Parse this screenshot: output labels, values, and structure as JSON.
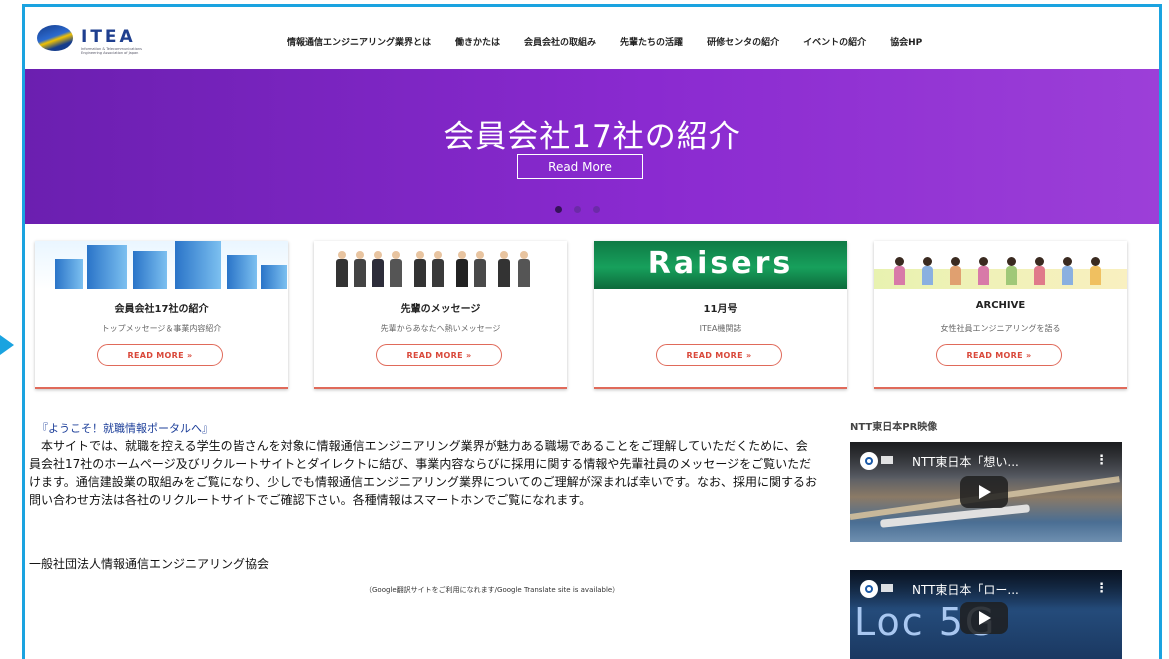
{
  "logo": {
    "name": "ITEA",
    "subtitle": "Information & Telecommunications Engineering Association of Japan"
  },
  "nav": [
    "情報通信エンジニアリング業界とは",
    "働きかたは",
    "会員会社の取組み",
    "先輩たちの活躍",
    "研修センタの紹介",
    "イベントの紹介",
    "協会HP"
  ],
  "hero": {
    "title": "会員会社17社の紹介",
    "button": "Read More",
    "slides": 3,
    "active_slide": 1
  },
  "cards": [
    {
      "title": "会員会社17社の紹介",
      "desc": "トップメッセージ＆事業内容紹介",
      "button": "READ MORE »",
      "image": "buildings-image"
    },
    {
      "title": "先輩のメッセージ",
      "desc": "先輩からあなたへ熱いメッセージ",
      "button": "READ MORE »",
      "image": "employees-image"
    },
    {
      "title": "11月号",
      "desc": "ITEA機関誌",
      "button": "READ MORE »",
      "image": "raisers-image",
      "image_text": "Raisers"
    },
    {
      "title": "ARCHIVE",
      "desc": "女性社員エンジニアリングを語る",
      "button": "READ MORE »",
      "image": "women-image"
    }
  ],
  "welcome": {
    "heading": "『ようこそ！就職情報ポータルへ』",
    "body": "　本サイトでは、就職を控える学生の皆さんを対象に情報通信エンジニアリング業界が魅力ある職場であることをご理解していただくために、会員会社17社のホームページ及びリクルートサイトとダイレクトに結び、事業内容ならびに採用に関する情報や先輩社員のメッセージをご覧いただけます。通信建設業の取組みをご覧になり、少しでも情報通信エンジニアリング業界についてのご理解が深まれば幸いです。なお、採用に関するお問い合わせ方法は各社のリクルートサイトでご確認下さい。各種情報はスマートホンでご覧になれます。",
    "org": "一般社団法人情報通信エンジニアリング協会",
    "translate_note": "（Google翻訳サイトをご利用になれます/Google Translate site is available）"
  },
  "sidebar": {
    "heading": "NTT東日本PR映像",
    "videos": [
      {
        "title": "NTT東日本「想い...",
        "menu": "⋮"
      },
      {
        "title": "NTT東日本「ロー...",
        "menu": "⋮",
        "overlay_text": "Loc 5G"
      }
    ]
  },
  "colors": {
    "accent": "#1aa3e0",
    "hero": "#8a2ad0",
    "button_border": "#e06a5a",
    "heading_blue": "#1d3f9a"
  }
}
